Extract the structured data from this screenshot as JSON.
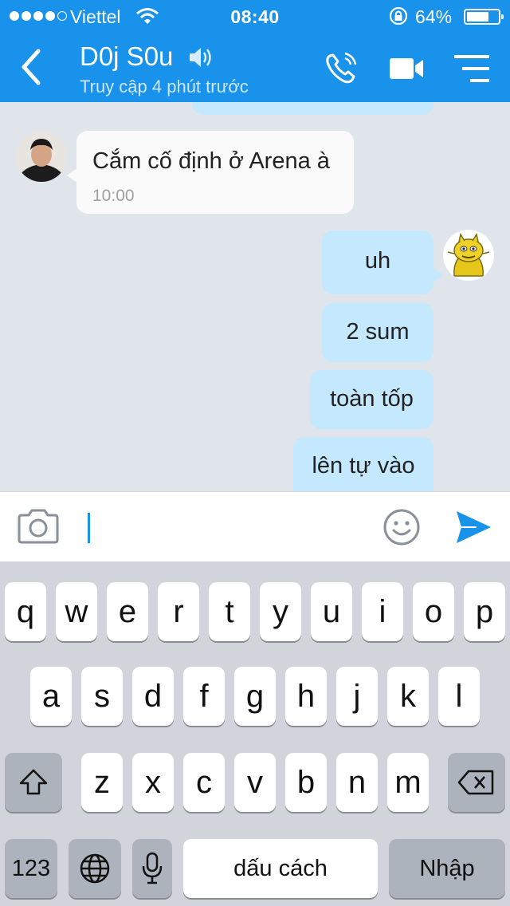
{
  "status_bar": {
    "carrier": "Viettel",
    "time": "08:40",
    "battery": "64%",
    "battery_level": 0.64
  },
  "header": {
    "contact_name": "D0j S0u",
    "last_seen": "Truy cập 4 phút trước",
    "icons": [
      "back-arrow-icon",
      "speaker-icon",
      "phone-call-icon",
      "video-camera-icon",
      "menu-icon"
    ]
  },
  "chat": {
    "messages": [
      {
        "direction": "in",
        "text": "Cắm cố định ở Arena à",
        "time": "10:00"
      },
      {
        "direction": "out",
        "text": "uh"
      },
      {
        "direction": "out",
        "text": "2 sum"
      },
      {
        "direction": "out",
        "text": "toàn tốp"
      },
      {
        "direction": "out",
        "text": "lên tự vào"
      }
    ]
  },
  "input_bar": {
    "value": "",
    "icons": [
      "camera-icon",
      "emoji-icon",
      "send-icon"
    ]
  },
  "keyboard": {
    "row1": [
      "q",
      "w",
      "e",
      "r",
      "t",
      "y",
      "u",
      "i",
      "o",
      "p"
    ],
    "row2": [
      "a",
      "s",
      "d",
      "f",
      "g",
      "h",
      "j",
      "k",
      "l"
    ],
    "row3": [
      "z",
      "x",
      "c",
      "v",
      "b",
      "n",
      "m"
    ],
    "numbers_key": "123",
    "space_key": "dấu cách",
    "return_key": "Nhập",
    "icons": [
      "shift-icon",
      "backspace-icon",
      "globe-icon",
      "microphone-icon"
    ]
  },
  "colors": {
    "brand": "#1892eb",
    "chat_background": "#dfe5eb",
    "incoming_bubble": "#fafafa",
    "outgoing_bubble": "#c4e8fd",
    "keyboard_background": "#d1d5db"
  }
}
